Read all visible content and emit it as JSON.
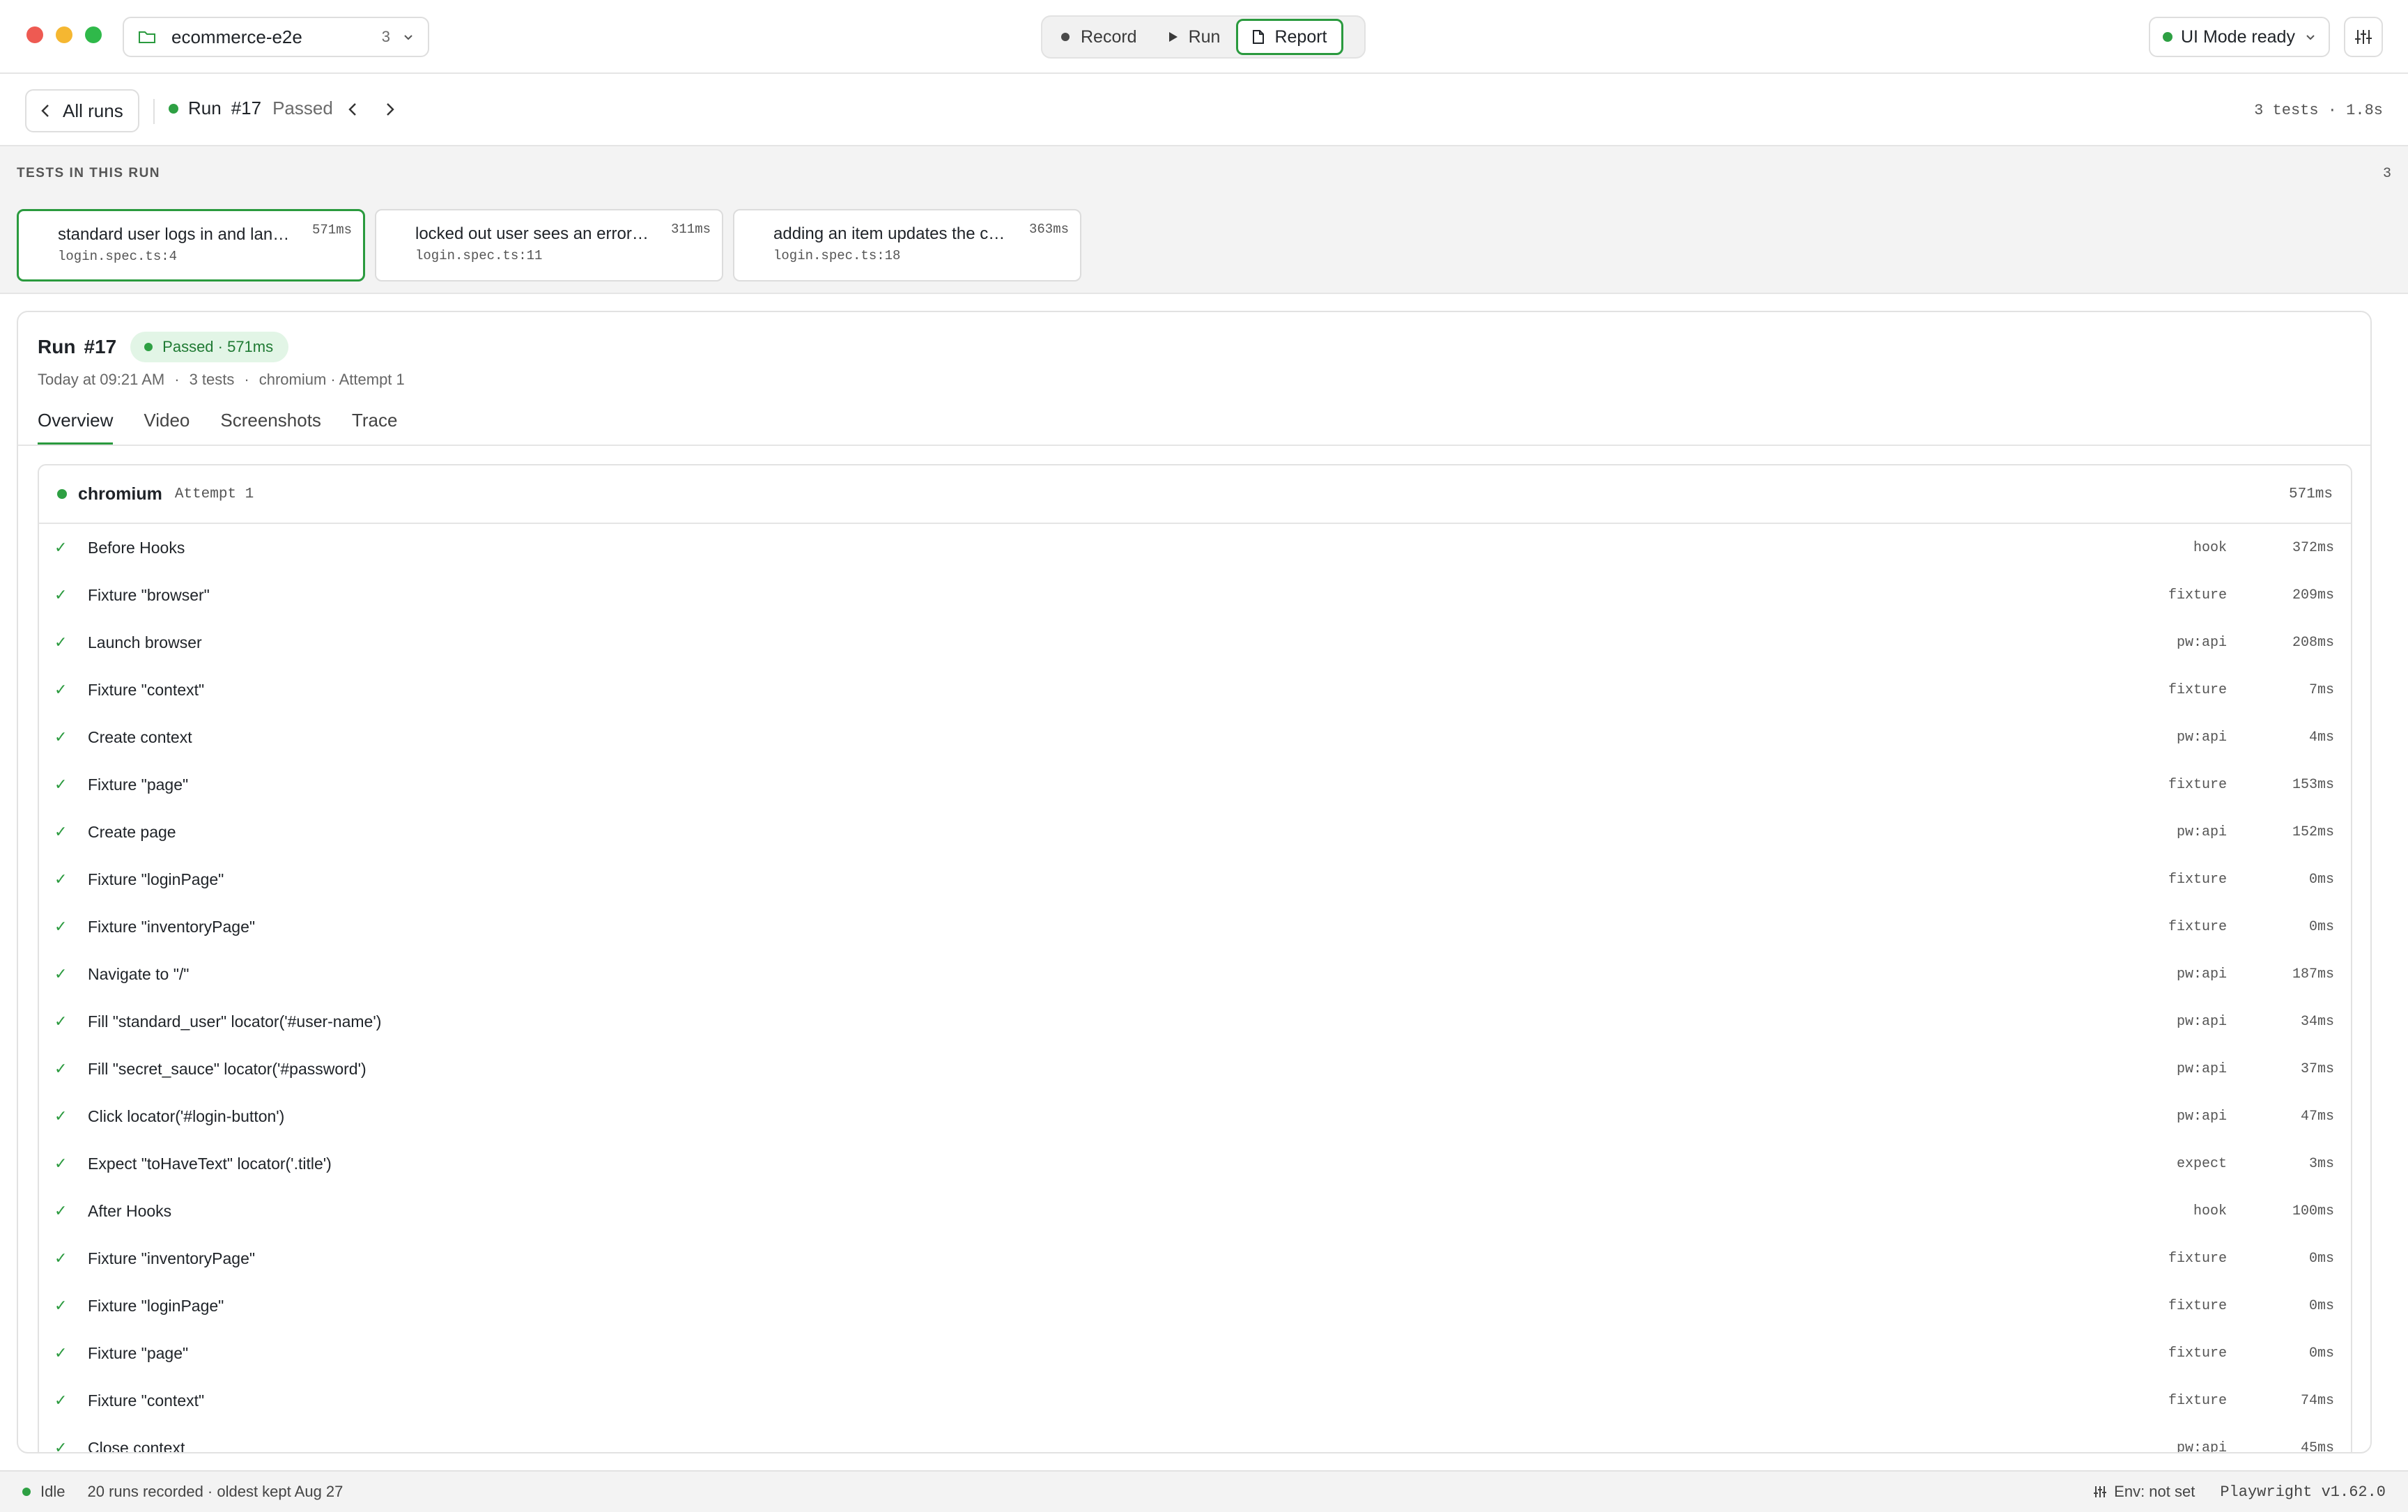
{
  "colors": {
    "accent": "#2a9a3e",
    "pass": "#2ea043",
    "close": "#ee5a52",
    "minimize": "#f5b731",
    "maximize": "#2fb94a"
  },
  "titlebar": {
    "project_name": "ecommerce-e2e",
    "project_count": "3",
    "modes": [
      {
        "label": "Record",
        "icon": "record-dot-icon"
      },
      {
        "label": "Run",
        "icon": "play-icon"
      },
      {
        "label": "Report",
        "icon": "document-icon",
        "active": true
      }
    ],
    "ui_mode_label": "UI Mode ready"
  },
  "runbar": {
    "all_runs_label": "All runs",
    "run_label": "Run",
    "run_number": "#17",
    "status": "Passed",
    "stats": "3 tests · 1.8s"
  },
  "tests_strip": {
    "heading": "TESTS IN THIS RUN",
    "count": "3",
    "tests": [
      {
        "title": "standard user logs in and lands on inventory",
        "file": "login.spec.ts:4",
        "duration": "571ms",
        "active": true
      },
      {
        "title": "locked out user sees an error message",
        "file": "login.spec.ts:11",
        "duration": "311ms"
      },
      {
        "title": "adding an item updates the cart badge",
        "file": "login.spec.ts:18",
        "duration": "363ms"
      }
    ]
  },
  "panel": {
    "run_label": "Run",
    "run_number": "#17",
    "badge": "Passed · 571ms",
    "meta": {
      "time": "Today at 09:21 AM",
      "sep1": "·",
      "tests": "3 tests",
      "sep2": "·",
      "env": "chromium · Attempt 1"
    },
    "tabs": [
      "Overview",
      "Video",
      "Screenshots",
      "Trace"
    ],
    "steps_header": {
      "browser": "chromium",
      "attempt": "Attempt 1",
      "duration": "571ms"
    },
    "steps": [
      {
        "title": "Before Hooks",
        "category": "hook",
        "duration": "372ms"
      },
      {
        "title": "Fixture \"browser\"",
        "category": "fixture",
        "duration": "209ms"
      },
      {
        "title": "Launch browser",
        "category": "pw:api",
        "duration": "208ms"
      },
      {
        "title": "Fixture \"context\"",
        "category": "fixture",
        "duration": "7ms"
      },
      {
        "title": "Create context",
        "category": "pw:api",
        "duration": "4ms"
      },
      {
        "title": "Fixture \"page\"",
        "category": "fixture",
        "duration": "153ms"
      },
      {
        "title": "Create page",
        "category": "pw:api",
        "duration": "152ms"
      },
      {
        "title": "Fixture \"loginPage\"",
        "category": "fixture",
        "duration": "0ms"
      },
      {
        "title": "Fixture \"inventoryPage\"",
        "category": "fixture",
        "duration": "0ms"
      },
      {
        "title": "Navigate to \"/\"",
        "category": "pw:api",
        "duration": "187ms"
      },
      {
        "title": "Fill \"standard_user\" locator('#user-name')",
        "category": "pw:api",
        "duration": "34ms"
      },
      {
        "title": "Fill \"secret_sauce\" locator('#password')",
        "category": "pw:api",
        "duration": "37ms"
      },
      {
        "title": "Click locator('#login-button')",
        "category": "pw:api",
        "duration": "47ms"
      },
      {
        "title": "Expect \"toHaveText\" locator('.title')",
        "category": "expect",
        "duration": "3ms"
      },
      {
        "title": "After Hooks",
        "category": "hook",
        "duration": "100ms"
      },
      {
        "title": "Fixture \"inventoryPage\"",
        "category": "fixture",
        "duration": "0ms"
      },
      {
        "title": "Fixture \"loginPage\"",
        "category": "fixture",
        "duration": "0ms"
      },
      {
        "title": "Fixture \"page\"",
        "category": "fixture",
        "duration": "0ms"
      },
      {
        "title": "Fixture \"context\"",
        "category": "fixture",
        "duration": "74ms"
      },
      {
        "title": "Close context",
        "category": "pw:api",
        "duration": "45ms"
      }
    ]
  },
  "statusbar": {
    "state": "Idle",
    "runs_info": "20 runs recorded · oldest kept Aug 27",
    "env": "Env: not set",
    "version": "Playwright v1.62.0"
  }
}
